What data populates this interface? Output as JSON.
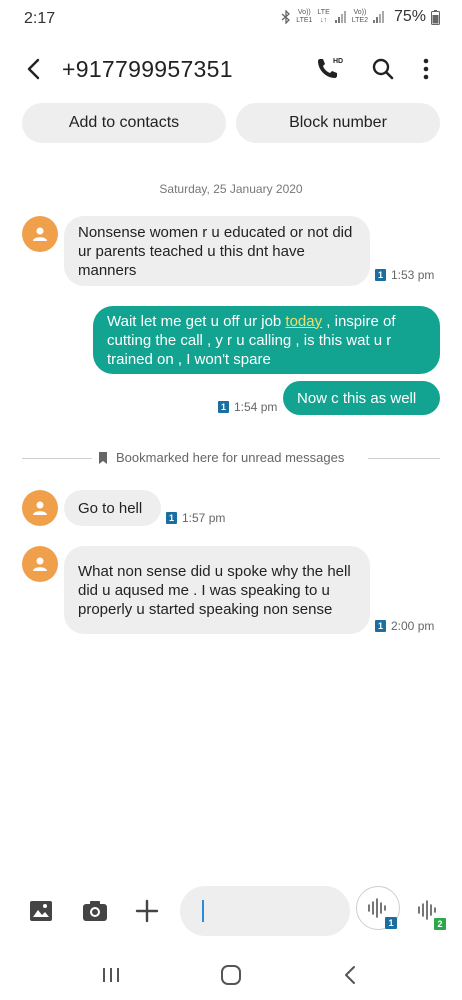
{
  "status_bar": {
    "time": "2:17",
    "sim1_label_top": "Vo))",
    "sim1_label_bottom": "LTE1",
    "lte_label": "LTE",
    "sim2_label_top": "Vo))",
    "sim2_label_bottom": "LTE2",
    "battery": "75%"
  },
  "header": {
    "title": "+917799957351",
    "call_hd_label": "HD"
  },
  "actions": {
    "add_contacts": "Add to contacts",
    "block_number": "Block number"
  },
  "conversation": {
    "date": "Saturday, 25 January 2020",
    "bookmark": "Bookmarked here for unread messages",
    "messages": [
      {
        "direction": "incoming",
        "text": "Nonsense women r u educated or not did ur parents teached u this dnt have manners",
        "time": "1:53 pm",
        "sim": "1"
      },
      {
        "direction": "outgoing",
        "text_before_link": "Wait let me get u off ur job ",
        "link_text": "today",
        "text_after_link": " , inspire of cutting the call , y r u calling , is this wat u r trained on , I won't spare"
      },
      {
        "direction": "outgoing",
        "text": "Now c this as well",
        "time": "1:54 pm",
        "sim": "1"
      },
      {
        "direction": "incoming",
        "text": "Go to hell",
        "time": "1:57 pm",
        "sim": "1"
      },
      {
        "direction": "incoming",
        "text": "What non sense did u spoke why the hell did u aqused me . I was speaking to u properly u started speaking non sense",
        "time": "2:00 pm",
        "sim": "1"
      }
    ]
  },
  "composer": {
    "voice_sim1": "1",
    "voice_sim2": "2"
  },
  "colors": {
    "outgoing_bubble": "#12a391",
    "incoming_bubble": "#eeeeee",
    "avatar": "#f0a04b",
    "sim1_badge": "#1b6fa0",
    "sim2_badge": "#2aa84a",
    "link": "#e8e06e"
  },
  "icons": {
    "back": "arrow-left-icon",
    "call": "phone-hd-icon",
    "search": "search-icon",
    "more": "more-vertical-icon",
    "avatar": "person-icon",
    "bookmark": "bookmark-icon",
    "gallery": "image-icon",
    "camera": "camera-icon",
    "attach": "plus-icon",
    "voice": "voice-wave-icon"
  }
}
